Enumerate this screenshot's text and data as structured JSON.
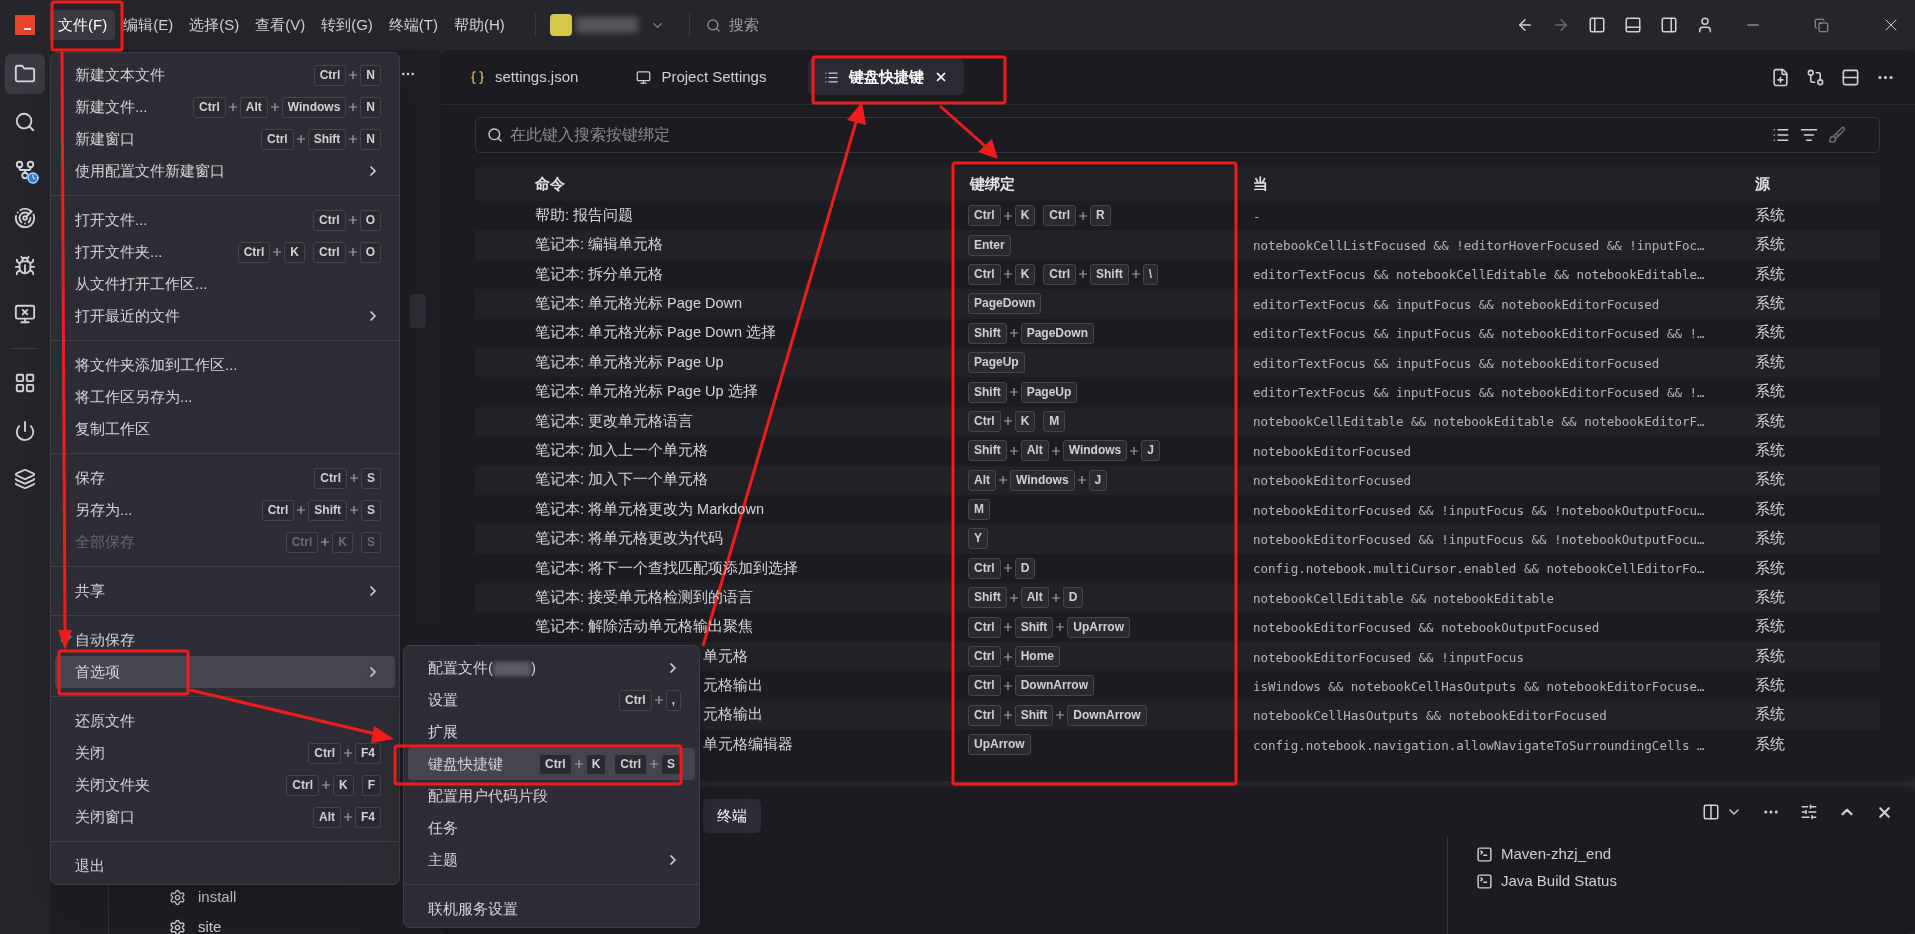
{
  "menubar": [
    {
      "label": "文件(F)",
      "selected": true
    },
    {
      "label": "编辑(E)",
      "selected": false
    },
    {
      "label": "选择(S)",
      "selected": false
    },
    {
      "label": "查看(V)",
      "selected": false
    },
    {
      "label": "转到(G)",
      "selected": false
    },
    {
      "label": "终端(T)",
      "selected": false
    },
    {
      "label": "帮助(H)",
      "selected": false
    }
  ],
  "search": {
    "placeholder": "搜索"
  },
  "activity_bar": [
    {
      "selected": true
    },
    {
      "selected": false
    },
    {
      "selected": false
    },
    {
      "selected": false
    },
    {
      "selected": false
    },
    {
      "selected": false
    },
    {
      "selected": false
    },
    {
      "selected": false
    },
    {
      "selected": false
    }
  ],
  "explorer": {
    "items": [
      {
        "label": "install"
      },
      {
        "label": "site"
      }
    ]
  },
  "tabs": [
    {
      "label": "settings.json",
      "selected": false
    },
    {
      "label": "Project Settings",
      "selected": false
    },
    {
      "label": "键盘快捷键",
      "selected": true
    }
  ],
  "keybindings": {
    "placeholder": "在此键入搜索按键绑定",
    "columns": [
      "命令",
      "键绑定",
      "当",
      "源"
    ],
    "rows": [
      {
        "command": "帮助: 报告问题",
        "clipped": false,
        "keys": [
          [
            "Ctrl",
            "K"
          ],
          [
            "Ctrl",
            "R"
          ]
        ],
        "when": "-",
        "source": "系统"
      },
      {
        "command": "笔记本: 编辑单元格",
        "clipped": false,
        "keys": [
          [
            "Enter"
          ]
        ],
        "when": "notebookCellListFocused && !editorHoverFocused && !inputFoc…",
        "source": "系统"
      },
      {
        "command": "笔记本: 拆分单元格",
        "clipped": false,
        "keys": [
          [
            "Ctrl",
            "K"
          ],
          [
            "Ctrl",
            "Shift",
            "\\"
          ]
        ],
        "when": "editorTextFocus && notebookCellEditable && notebookEditable…",
        "source": "系统"
      },
      {
        "command": "笔记本: 单元格光标 Page Down",
        "clipped": false,
        "keys": [
          [
            "PageDown"
          ]
        ],
        "when": "editorTextFocus && inputFocus && notebookEditorFocused",
        "source": "系统"
      },
      {
        "command": "笔记本: 单元格光标 Page Down 选择",
        "clipped": false,
        "keys": [
          [
            "Shift",
            "PageDown"
          ]
        ],
        "when": "editorTextFocus && inputFocus && notebookEditorFocused && !…",
        "source": "系统"
      },
      {
        "command": "笔记本: 单元格光标 Page Up",
        "clipped": false,
        "keys": [
          [
            "PageUp"
          ]
        ],
        "when": "editorTextFocus && inputFocus && notebookEditorFocused",
        "source": "系统"
      },
      {
        "command": "笔记本: 单元格光标 Page Up 选择",
        "clipped": false,
        "keys": [
          [
            "Shift",
            "PageUp"
          ]
        ],
        "when": "editorTextFocus && inputFocus && notebookEditorFocused && !…",
        "source": "系统"
      },
      {
        "command": "笔记本: 更改单元格语言",
        "clipped": false,
        "keys": [
          [
            "Ctrl",
            "K"
          ],
          [
            "M"
          ]
        ],
        "when": "notebookCellEditable && notebookEditable && notebookEditorF…",
        "source": "系统"
      },
      {
        "command": "笔记本: 加入上一个单元格",
        "clipped": false,
        "keys": [
          [
            "Shift",
            "Alt",
            "Windows",
            "J"
          ]
        ],
        "when": "notebookEditorFocused",
        "source": "系统"
      },
      {
        "command": "笔记本: 加入下一个单元格",
        "clipped": false,
        "keys": [
          [
            "Alt",
            "Windows",
            "J"
          ]
        ],
        "when": "notebookEditorFocused",
        "source": "系统"
      },
      {
        "command": "笔记本: 将单元格更改为 Markdown",
        "clipped": false,
        "keys": [
          [
            "M"
          ]
        ],
        "when": "notebookEditorFocused && !inputFocus && !notebookOutputFocu…",
        "source": "系统"
      },
      {
        "command": "笔记本: 将单元格更改为代码",
        "clipped": false,
        "keys": [
          [
            "Y"
          ]
        ],
        "when": "notebookEditorFocused && !inputFocus && !notebookOutputFocu…",
        "source": "系统"
      },
      {
        "command": "笔记本: 将下一个查找匹配项添加到选择",
        "clipped": false,
        "keys": [
          [
            "Ctrl",
            "D"
          ]
        ],
        "when": "config.notebook.multiCursor.enabled && notebookCellEditorFo…",
        "source": "系统"
      },
      {
        "command": "笔记本: 接受单元格检测到的语言",
        "clipped": false,
        "keys": [
          [
            "Shift",
            "Alt",
            "D"
          ]
        ],
        "when": "notebookCellEditable && notebookEditable",
        "source": "系统"
      },
      {
        "command": "笔记本: 解除活动单元格输出聚焦",
        "clipped": false,
        "keys": [
          [
            "Ctrl",
            "Shift",
            "UpArrow"
          ]
        ],
        "when": "notebookEditorFocused && notebookOutputFocused",
        "source": "系统"
      },
      {
        "command": "单元格",
        "clipped": true,
        "keys": [
          [
            "Ctrl",
            "Home"
          ]
        ],
        "when": "notebookEditorFocused && !inputFocus",
        "source": "系统"
      },
      {
        "command": "元格输出",
        "clipped": true,
        "keys": [
          [
            "Ctrl",
            "DownArrow"
          ]
        ],
        "when": "isWindows && notebookCellHasOutputs && notebookEditorFocuse…",
        "source": "系统"
      },
      {
        "command": "元格输出",
        "clipped": true,
        "keys": [
          [
            "Ctrl",
            "Shift",
            "DownArrow"
          ]
        ],
        "when": "notebookCellHasOutputs && notebookEditorFocused",
        "source": "系统"
      },
      {
        "command": "单元格编辑器",
        "clipped": true,
        "keys": [
          [
            "UpArrow"
          ]
        ],
        "when": "config.notebook.navigation.allowNavigateToSurroundingCells …",
        "source": "系统"
      }
    ]
  },
  "panel": {
    "tabs": [
      {
        "label": "终端",
        "selected": true
      }
    ],
    "terminals": [
      {
        "label": "Maven-zhzj_end"
      },
      {
        "label": "Java Build Status"
      }
    ]
  },
  "file_menu": {
    "groups": [
      [
        {
          "label": "新建文本文件",
          "keys": [
            [
              "Ctrl",
              "N"
            ]
          ],
          "submenu": false,
          "selected": false,
          "disabled": false,
          "checked": false
        },
        {
          "label": "新建文件...",
          "keys": [
            [
              "Ctrl",
              "Alt",
              "Windows",
              "N"
            ]
          ],
          "submenu": false,
          "selected": false,
          "disabled": false,
          "checked": false
        },
        {
          "label": "新建窗口",
          "keys": [
            [
              "Ctrl",
              "Shift",
              "N"
            ]
          ],
          "submenu": false,
          "selected": false,
          "disabled": false,
          "checked": false
        },
        {
          "label": "使用配置文件新建窗口",
          "submenu": true,
          "selected": false,
          "disabled": false,
          "checked": false
        }
      ],
      [
        {
          "label": "打开文件...",
          "keys": [
            [
              "Ctrl",
              "O"
            ]
          ],
          "submenu": false,
          "selected": false,
          "disabled": false,
          "checked": false
        },
        {
          "label": "打开文件夹...",
          "keys": [
            [
              "Ctrl",
              "K"
            ],
            [
              "Ctrl",
              "O"
            ]
          ],
          "submenu": false,
          "selected": false,
          "disabled": false,
          "checked": false
        },
        {
          "label": "从文件打开工作区...",
          "submenu": false,
          "selected": false,
          "disabled": false,
          "checked": false
        },
        {
          "label": "打开最近的文件",
          "submenu": true,
          "selected": false,
          "disabled": false,
          "checked": false
        }
      ],
      [
        {
          "label": "将文件夹添加到工作区...",
          "submenu": false,
          "selected": false,
          "disabled": false,
          "checked": false
        },
        {
          "label": "将工作区另存为...",
          "submenu": false,
          "selected": false,
          "disabled": false,
          "checked": false
        },
        {
          "label": "复制工作区",
          "submenu": false,
          "selected": false,
          "disabled": false,
          "checked": false
        }
      ],
      [
        {
          "label": "保存",
          "keys": [
            [
              "Ctrl",
              "S"
            ]
          ],
          "submenu": false,
          "selected": false,
          "disabled": false,
          "checked": false
        },
        {
          "label": "另存为...",
          "keys": [
            [
              "Ctrl",
              "Shift",
              "S"
            ]
          ],
          "submenu": false,
          "selected": false,
          "disabled": false,
          "checked": false
        },
        {
          "label": "全部保存",
          "keys": [
            [
              "Ctrl",
              "K"
            ],
            [
              "S"
            ]
          ],
          "submenu": false,
          "selected": false,
          "disabled": true,
          "checked": false
        }
      ],
      [
        {
          "label": "共享",
          "submenu": true,
          "selected": false,
          "disabled": false,
          "checked": false
        }
      ],
      [
        {
          "label": "自动保存",
          "submenu": false,
          "selected": false,
          "disabled": false,
          "checked": true
        },
        {
          "label": "首选项",
          "submenu": true,
          "selected": true,
          "disabled": false,
          "checked": false
        }
      ],
      [
        {
          "label": "还原文件",
          "submenu": false,
          "selected": false,
          "disabled": false,
          "checked": false
        },
        {
          "label": "关闭",
          "keys": [
            [
              "Ctrl",
              "F4"
            ]
          ],
          "submenu": false,
          "selected": false,
          "disabled": false,
          "checked": false
        },
        {
          "label": "关闭文件夹",
          "keys": [
            [
              "Ctrl",
              "K"
            ],
            [
              "F"
            ]
          ],
          "submenu": false,
          "selected": false,
          "disabled": false,
          "checked": false
        },
        {
          "label": "关闭窗口",
          "keys": [
            [
              "Alt",
              "F4"
            ]
          ],
          "submenu": false,
          "selected": false,
          "disabled": false,
          "checked": false
        }
      ],
      [
        {
          "label": "退出",
          "submenu": false,
          "selected": false,
          "disabled": false,
          "checked": false
        }
      ]
    ]
  },
  "preferences_menu": {
    "groups": [
      [
        {
          "label": "配置文件(",
          "redacted": true,
          "label_end": ")",
          "submenu": true,
          "selected": false
        },
        {
          "label": "设置",
          "keys": [
            [
              "Ctrl",
              ","
            ]
          ],
          "submenu": false,
          "selected": false
        },
        {
          "label": "扩展",
          "submenu": false,
          "selected": false
        },
        {
          "label": "键盘快捷键",
          "keys": [
            [
              "Ctrl",
              "K"
            ],
            [
              "Ctrl",
              "S"
            ]
          ],
          "submenu": false,
          "selected": true
        },
        {
          "label": "配置用户代码片段",
          "submenu": false,
          "selected": false
        },
        {
          "label": "任务",
          "submenu": false,
          "selected": false
        },
        {
          "label": "主题",
          "submenu": true,
          "selected": false
        }
      ],
      [
        {
          "label": "联机服务设置",
          "submenu": false,
          "selected": false
        }
      ]
    ]
  }
}
